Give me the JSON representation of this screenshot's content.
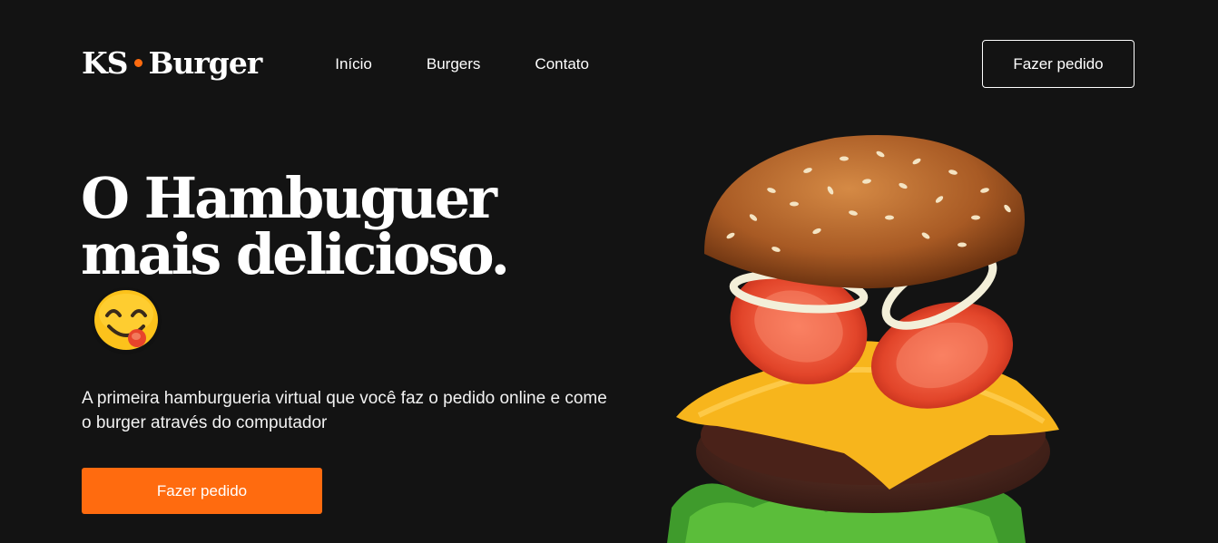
{
  "header": {
    "logo_left": "KS",
    "logo_right": "Burger",
    "nav": [
      {
        "label": "Início"
      },
      {
        "label": "Burgers"
      },
      {
        "label": "Contato"
      }
    ],
    "order_button": "Fazer pedido"
  },
  "hero": {
    "title_line1": "O Hambuguer",
    "title_line2": "mais delicioso.",
    "description": "A primeira hamburgueria virtual que você faz o pedido online e come o burger através do computador",
    "cta_button": "Fazer pedido"
  },
  "colors": {
    "background": "#131313",
    "accent": "#ff6b0f",
    "text": "#ffffff"
  },
  "icons": {
    "emoji": "savoring-food-emoji",
    "hero_image": "burger-image"
  }
}
